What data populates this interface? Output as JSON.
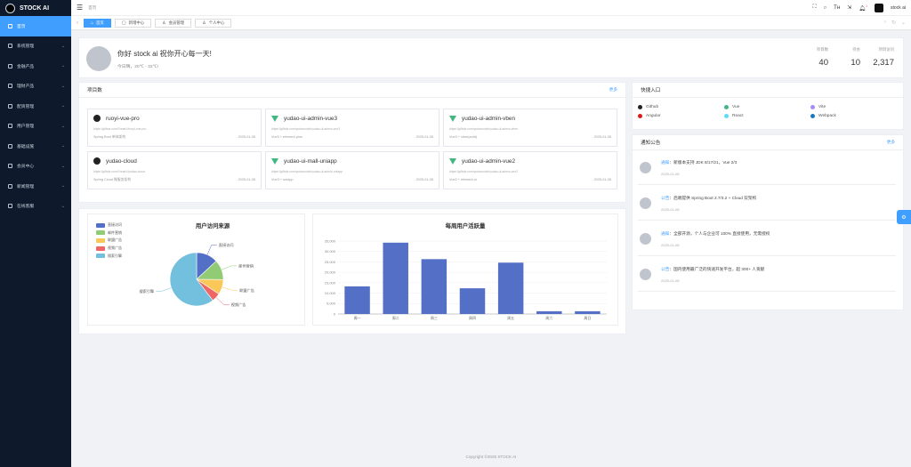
{
  "app": {
    "title": "STOCK AI"
  },
  "sidebar": {
    "items": [
      {
        "label": "首页",
        "icon": "home-icon",
        "active": true,
        "has_children": false
      },
      {
        "label": "系统管理",
        "icon": "setting-icon",
        "has_children": true
      },
      {
        "label": "金融产品",
        "icon": "product-icon",
        "has_children": true
      },
      {
        "label": "理财产品",
        "icon": "money-icon",
        "has_children": true
      },
      {
        "label": "配资管理",
        "icon": "fund-icon",
        "has_children": true
      },
      {
        "label": "用户管理",
        "icon": "user-icon",
        "has_children": true
      },
      {
        "label": "基础设施",
        "icon": "server-icon",
        "has_children": true
      },
      {
        "label": "会员中心",
        "icon": "member-icon",
        "has_children": true
      },
      {
        "label": "新闻管理",
        "icon": "news-icon",
        "has_children": true
      },
      {
        "label": "在线客服",
        "icon": "service-icon",
        "has_children": true
      }
    ]
  },
  "header": {
    "breadcrumb": "首页",
    "username": "stock ai",
    "badge": "1"
  },
  "tabs": [
    {
      "label": "首页",
      "active": true,
      "icon": "home-icon"
    },
    {
      "label": "新增中心",
      "icon": "document-icon"
    },
    {
      "label": "会员管理",
      "icon": "user-icon"
    },
    {
      "label": "个人中心",
      "icon": "person-icon"
    }
  ],
  "welcome": {
    "greeting": "你好 stock ai 祝你开心每一天!",
    "weather": "今日晴，20℃ - 32℃!",
    "stats": [
      {
        "label": "项目数",
        "value": "40"
      },
      {
        "label": "待办",
        "value": "10"
      },
      {
        "label": "项目访问",
        "value": "2,317"
      }
    ]
  },
  "projects": {
    "title": "项目数",
    "more": "更多",
    "items": [
      {
        "name": "ruoyi-vue-pro",
        "icon": "github-icon",
        "url": "https://github.com/YunaiV/ruoyi-vue-pro",
        "tech": "Spring Boot 单体架构",
        "date": "2025-01-08"
      },
      {
        "name": "yudao-ui-admin-vue3",
        "icon": "vue-icon",
        "url": "https://github.com/yudaocode/yudao-ui-admin-vue3",
        "tech": "Vue3 + element-plus",
        "date": "2025-01-08"
      },
      {
        "name": "yudao-ui-admin-vben",
        "icon": "vue-icon",
        "url": "https://github.com/yudaocode/yudao-ui-admin-vben",
        "tech": "Vue3 + vben(antd)",
        "date": "2025-01-08"
      },
      {
        "name": "yudao-cloud",
        "icon": "github-icon",
        "url": "https://github.com/YunaiV/yudao-cloud",
        "tech": "Spring Cloud 微服务架构",
        "date": "2025-01-08"
      },
      {
        "name": "yudao-ui-mall-uniapp",
        "icon": "vue-icon",
        "url": "https://github.com/yudaocode/yudao-ui-admin-uniapp",
        "tech": "Vue3 + uniapp",
        "date": "2025-01-08"
      },
      {
        "name": "yudao-ui-admin-vue2",
        "icon": "vue-icon",
        "url": "https://github.com/yudaocode/yudao-ui-admin-vue2",
        "tech": "Vue2 + element-ui",
        "date": "2025-01-08"
      }
    ]
  },
  "quick": {
    "title": "快捷入口",
    "items": [
      {
        "label": "Github",
        "color": "#222222",
        "icon": "github-icon"
      },
      {
        "label": "Vue",
        "color": "#42b883",
        "icon": "vue-icon"
      },
      {
        "label": "Vite",
        "color": "#a78bfa",
        "icon": "vite-icon"
      },
      {
        "label": "Angular",
        "color": "#dd1b16",
        "icon": "angular-icon"
      },
      {
        "label": "React",
        "color": "#61dafb",
        "icon": "react-icon"
      },
      {
        "label": "Webpack",
        "color": "#1c78c0",
        "icon": "webpack-icon"
      }
    ]
  },
  "notice": {
    "title": "通知公告",
    "more": "更多",
    "items": [
      {
        "type": "通知",
        "text": "新版本支持 JDK 8/17/21，Vue 2/3",
        "date": "2025-01-08"
      },
      {
        "type": "公告",
        "text": "后端提供 Spring Boot 2.7/3.2 + Cloud 双架构",
        "date": "2025-01-08"
      },
      {
        "type": "通知",
        "text": "全部开源，个人与企业可 100% 直接使用，无需授权",
        "date": "2025-01-08"
      },
      {
        "type": "公告",
        "text": "国内使用最广泛的快速开发平台，超 300+ 人贡献",
        "date": "2025-01-08"
      }
    ]
  },
  "chart_data": [
    {
      "type": "pie",
      "title": "用户访问来源",
      "categories": [
        "直接访问",
        "邮件营销",
        "联盟广告",
        "视频广告",
        "搜索引擎"
      ],
      "values": [
        335,
        310,
        234,
        135,
        1548
      ],
      "colors": [
        "#5470c6",
        "#91cc75",
        "#fac858",
        "#ee6666",
        "#73c0de"
      ],
      "legend": "top-left"
    },
    {
      "type": "bar",
      "title": "每周用户活跃量",
      "categories": [
        "周一",
        "周二",
        "周三",
        "周四",
        "周五",
        "周六",
        "周日"
      ],
      "values": [
        13253,
        34235,
        26321,
        12340,
        24643,
        1322,
        1324
      ],
      "ylim": [
        0,
        35000
      ],
      "yticks": [
        "0",
        "5,000",
        "10,000",
        "15,000",
        "20,000",
        "25,000",
        "30,000",
        "35,000"
      ],
      "color": "#5470c6",
      "grid": true
    }
  ],
  "footer": {
    "text": "Copyright ©2025 STOCK AI"
  }
}
